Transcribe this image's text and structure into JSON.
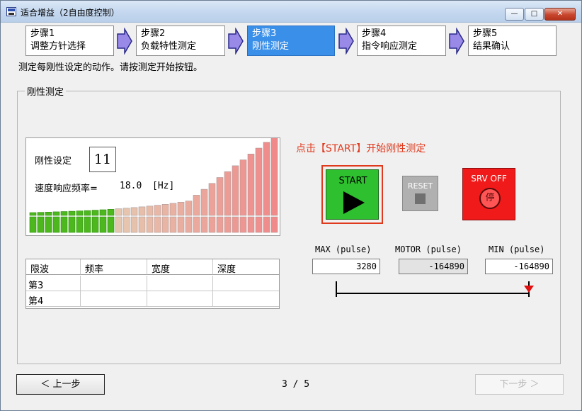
{
  "window": {
    "title": "适合增益（2自由度控制）",
    "controls": {
      "minimize": "—",
      "maximize": "□",
      "close": "✕"
    }
  },
  "steps": [
    {
      "line1": "步骤1",
      "line2": "调整方针选择",
      "active": false
    },
    {
      "line1": "步骤2",
      "line2": "负载特性测定",
      "active": false
    },
    {
      "line1": "步骤3",
      "line2": "刚性测定",
      "active": true
    },
    {
      "line1": "步骤4",
      "line2": "指令响应测定",
      "active": false
    },
    {
      "line1": "步骤5",
      "line2": "结果确认",
      "active": false
    }
  ],
  "instruction": "测定每刚性设定的动作。请按测定开始按钮。",
  "group": {
    "title": "刚性测定",
    "stiffness_label": "刚性设定",
    "stiffness_value": "11",
    "freq_label": "速度响应频率=",
    "freq_value": "18.0",
    "freq_unit": "[Hz]",
    "bar_level": 11,
    "bar_count": 32
  },
  "hint": "点击【START】开始刚性测定",
  "buttons": {
    "start": "START",
    "reset": "RESET",
    "srv_off": "SRV OFF",
    "srv_icon_char": "停"
  },
  "values": {
    "max_label": "MAX (pulse)",
    "motor_label": "MOTOR (pulse)",
    "min_label": "MIN (pulse)",
    "max": "3280",
    "motor": "-164890",
    "min": "-164890"
  },
  "filter_table": {
    "headers": [
      "限波",
      "频率",
      "宽度",
      "深度"
    ],
    "rows": [
      [
        "第3",
        "",
        "",
        ""
      ],
      [
        "第4",
        "",
        "",
        ""
      ]
    ]
  },
  "nav": {
    "prev": "＜ 上一步",
    "page": "3 / 5",
    "next": "下一步 ＞"
  },
  "colors": {
    "active_step": "#3a8fe8",
    "bar_filled": "#4cb81e",
    "bar_low": "#dfe8c4",
    "bar_high": "#f08a8a",
    "hint_red": "#e03a1e",
    "start_green": "#2ec02e",
    "srv_red": "#f01a1a"
  }
}
